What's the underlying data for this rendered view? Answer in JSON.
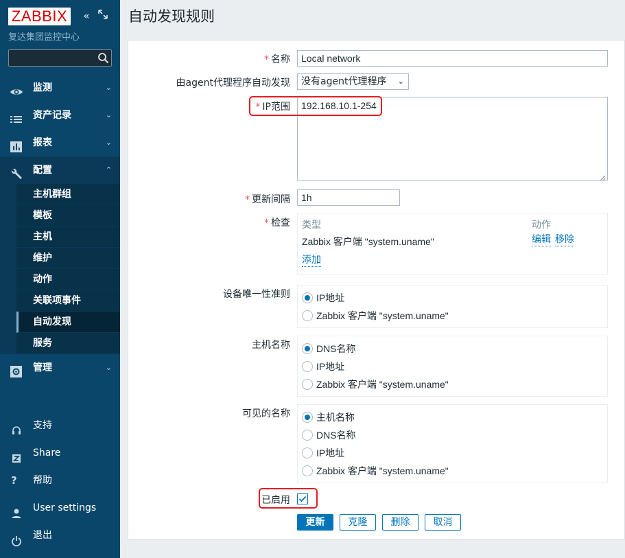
{
  "sidebar": {
    "logo": "ZABBIX",
    "server_name": "复达集团监控中心",
    "search": {
      "value": "",
      "placeholder": ""
    },
    "menu": [
      {
        "label": "监测",
        "icon": "eye-icon"
      },
      {
        "label": "资产记录",
        "icon": "list-icon"
      },
      {
        "label": "报表",
        "icon": "bar-chart-icon"
      },
      {
        "label": "配置",
        "icon": "wrench-icon"
      },
      {
        "label": "管理",
        "icon": "gear-icon"
      }
    ],
    "config_submenu": [
      "主机群组",
      "模板",
      "主机",
      "维护",
      "动作",
      "关联项事件",
      "自动发现",
      "服务"
    ],
    "active_submenu": "自动发现",
    "bottom": [
      {
        "label": "支持",
        "icon": "headset-icon"
      },
      {
        "label": "Share",
        "icon": "share-icon"
      },
      {
        "label": "帮助",
        "icon": "help-icon"
      },
      {
        "label": "User settings",
        "icon": "user-icon"
      },
      {
        "label": "退出",
        "icon": "power-icon"
      }
    ]
  },
  "header": {
    "title": "自动发现规则"
  },
  "form": {
    "name": {
      "label": "名称",
      "value": "Local network"
    },
    "proxy": {
      "label": "由agent代理程序自动发现",
      "value": "没有agent代理程序"
    },
    "ip_range": {
      "label": "IP范围",
      "value": "192.168.10.1-254"
    },
    "update_interval": {
      "label": "更新间隔",
      "value": "1h"
    },
    "checks": {
      "label": "检查",
      "col_type": "类型",
      "col_action": "动作",
      "rows": [
        {
          "type": "Zabbix 客户端 \"system.uname\"",
          "edit": "编辑",
          "remove": "移除"
        }
      ],
      "add": "添加"
    },
    "uniqueness": {
      "label": "设备唯一性准则",
      "options": [
        "IP地址",
        "Zabbix 客户端 \"system.uname\""
      ],
      "selected": 0
    },
    "host_name": {
      "label": "主机名称",
      "options": [
        "DNS名称",
        "IP地址",
        "Zabbix 客户端 \"system.uname\""
      ],
      "selected": 0
    },
    "visible_name": {
      "label": "可见的名称",
      "options": [
        "主机名称",
        "DNS名称",
        "IP地址",
        "Zabbix 客户端 \"system.uname\""
      ],
      "selected": 0
    },
    "enabled": {
      "label": "已启用",
      "checked": true
    },
    "buttons": {
      "update": "更新",
      "clone": "克隆",
      "delete": "删除",
      "cancel": "取消"
    }
  },
  "colors": {
    "accent": "#0275b8",
    "sidebar": "#0a466a",
    "required": "#e45959",
    "highlight": "#e41d23"
  }
}
